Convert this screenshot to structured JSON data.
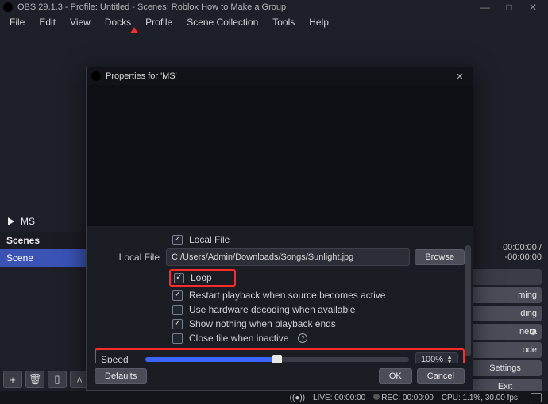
{
  "window": {
    "title": "OBS 29.1.3 - Profile: Untitled - Scenes: Roblox How to Make a Group"
  },
  "menu": {
    "items": [
      "File",
      "Edit",
      "View",
      "Docks",
      "Profile",
      "Scene Collection",
      "Tools",
      "Help"
    ]
  },
  "sources": {
    "current": "MS"
  },
  "scenes": {
    "header": "Scenes",
    "items": [
      "Scene"
    ]
  },
  "timecode": "00:00:00 / -00:00:00",
  "right": {
    "b0": "",
    "b1": "ming",
    "b2": "ding",
    "b3": "nera",
    "b4": "ode",
    "b5": "Settings",
    "b6": "Exit"
  },
  "dialog": {
    "title": "Properties for 'MS'",
    "localFileLabel": "Local File",
    "localFileCb": "Local File",
    "filePath": "C:/Users/Admin/Downloads/Songs/Sunlight.jpg",
    "browse": "Browse",
    "cb": {
      "loop": "Loop",
      "restart": "Restart playback when source becomes active",
      "hw": "Use hardware decoding when available",
      "shownothing": "Show nothing when playback ends",
      "closefile": "Close file when inactive"
    },
    "speedLabel": "Speed",
    "speedValue": "100%",
    "defaults": "Defaults",
    "ok": "OK",
    "cancel": "Cancel"
  },
  "status": {
    "live": "LIVE: 00:00:00",
    "rec": "REC: 00:00:00",
    "cpu": "CPU: 1.1%, 30.00 fps"
  }
}
